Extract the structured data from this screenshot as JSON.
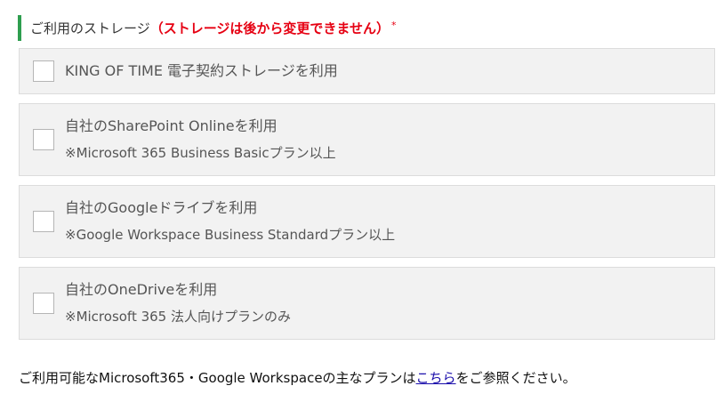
{
  "section": {
    "label": "ご利用のストレージ",
    "warning": "（ストレージは後から変更できません）",
    "required_mark": "*"
  },
  "options": [
    {
      "label": "KING OF TIME 電子契約ストレージを利用",
      "note": "",
      "checked": false
    },
    {
      "label": "自社のSharePoint Onlineを利用",
      "note": "※Microsoft 365 Business Basicプラン以上",
      "checked": false
    },
    {
      "label": "自社のGoogleドライブを利用",
      "note": "※Google Workspace Business Standardプラン以上",
      "checked": false
    },
    {
      "label": "自社のOneDriveを利用",
      "note": "※Microsoft 365 法人向けプランのみ",
      "checked": false
    }
  ],
  "footer": {
    "prefix": "ご利用可能なMicrosoft365・Google Workspaceの主なプランは",
    "link_text": "こちら",
    "suffix": "をご参照ください。"
  },
  "colors": {
    "accent_bar": "#2e9e4f",
    "warning": "#e60012",
    "link": "#1a0dab",
    "option_bg": "#f2f2f2"
  }
}
